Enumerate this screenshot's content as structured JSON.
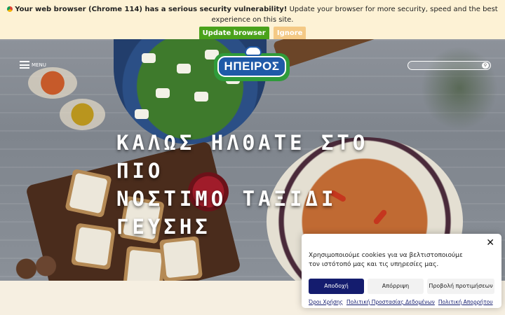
{
  "update_bar": {
    "bold_text": "Your web browser (Chrome 114) has a serious security vulnerability!",
    "text": "Update your browser for more security, speed and the best experience on this site.",
    "update_label": "Update browser",
    "ignore_label": "Ignore"
  },
  "header": {
    "menu_label": "MENU",
    "logo_text": "ΗΠΕΙΡΟΣ",
    "search_placeholder": ""
  },
  "hero": {
    "line1": "ΚΑΛΩΣ ΗΛΘΑΤΕ ΣΤΟ ΠΙΟ",
    "line2": "ΝΟΣΤΙΜΟ ΤΑΞΙΔΙ ΓΕΥΣΗΣ"
  },
  "cookie": {
    "message": "Χρησιμοποιούμε cookies για να βελτιστοποιούμε τον ιστότοπό μας και τις υπηρεσίες μας.",
    "accept_label": "Αποδοχή",
    "deny_label": "Απόρριψη",
    "prefs_label": "Προβολή προτιμήσεων",
    "close_label": "✕",
    "links": [
      "Όροι Χρήσης",
      "Πολιτική Προστασίας Δεδομένων",
      "Πολιτική Απορρήτου"
    ]
  },
  "colors": {
    "update_button": "#4aa21b",
    "ignore_button": "#f4c985",
    "accept_button": "#141c6e",
    "logo_blue": "#1f5aa8",
    "logo_green": "#2f9b3a"
  },
  "icons": {
    "browser": "chrome-icon",
    "menu": "hamburger-icon",
    "search": "search-icon",
    "close": "close-icon"
  }
}
